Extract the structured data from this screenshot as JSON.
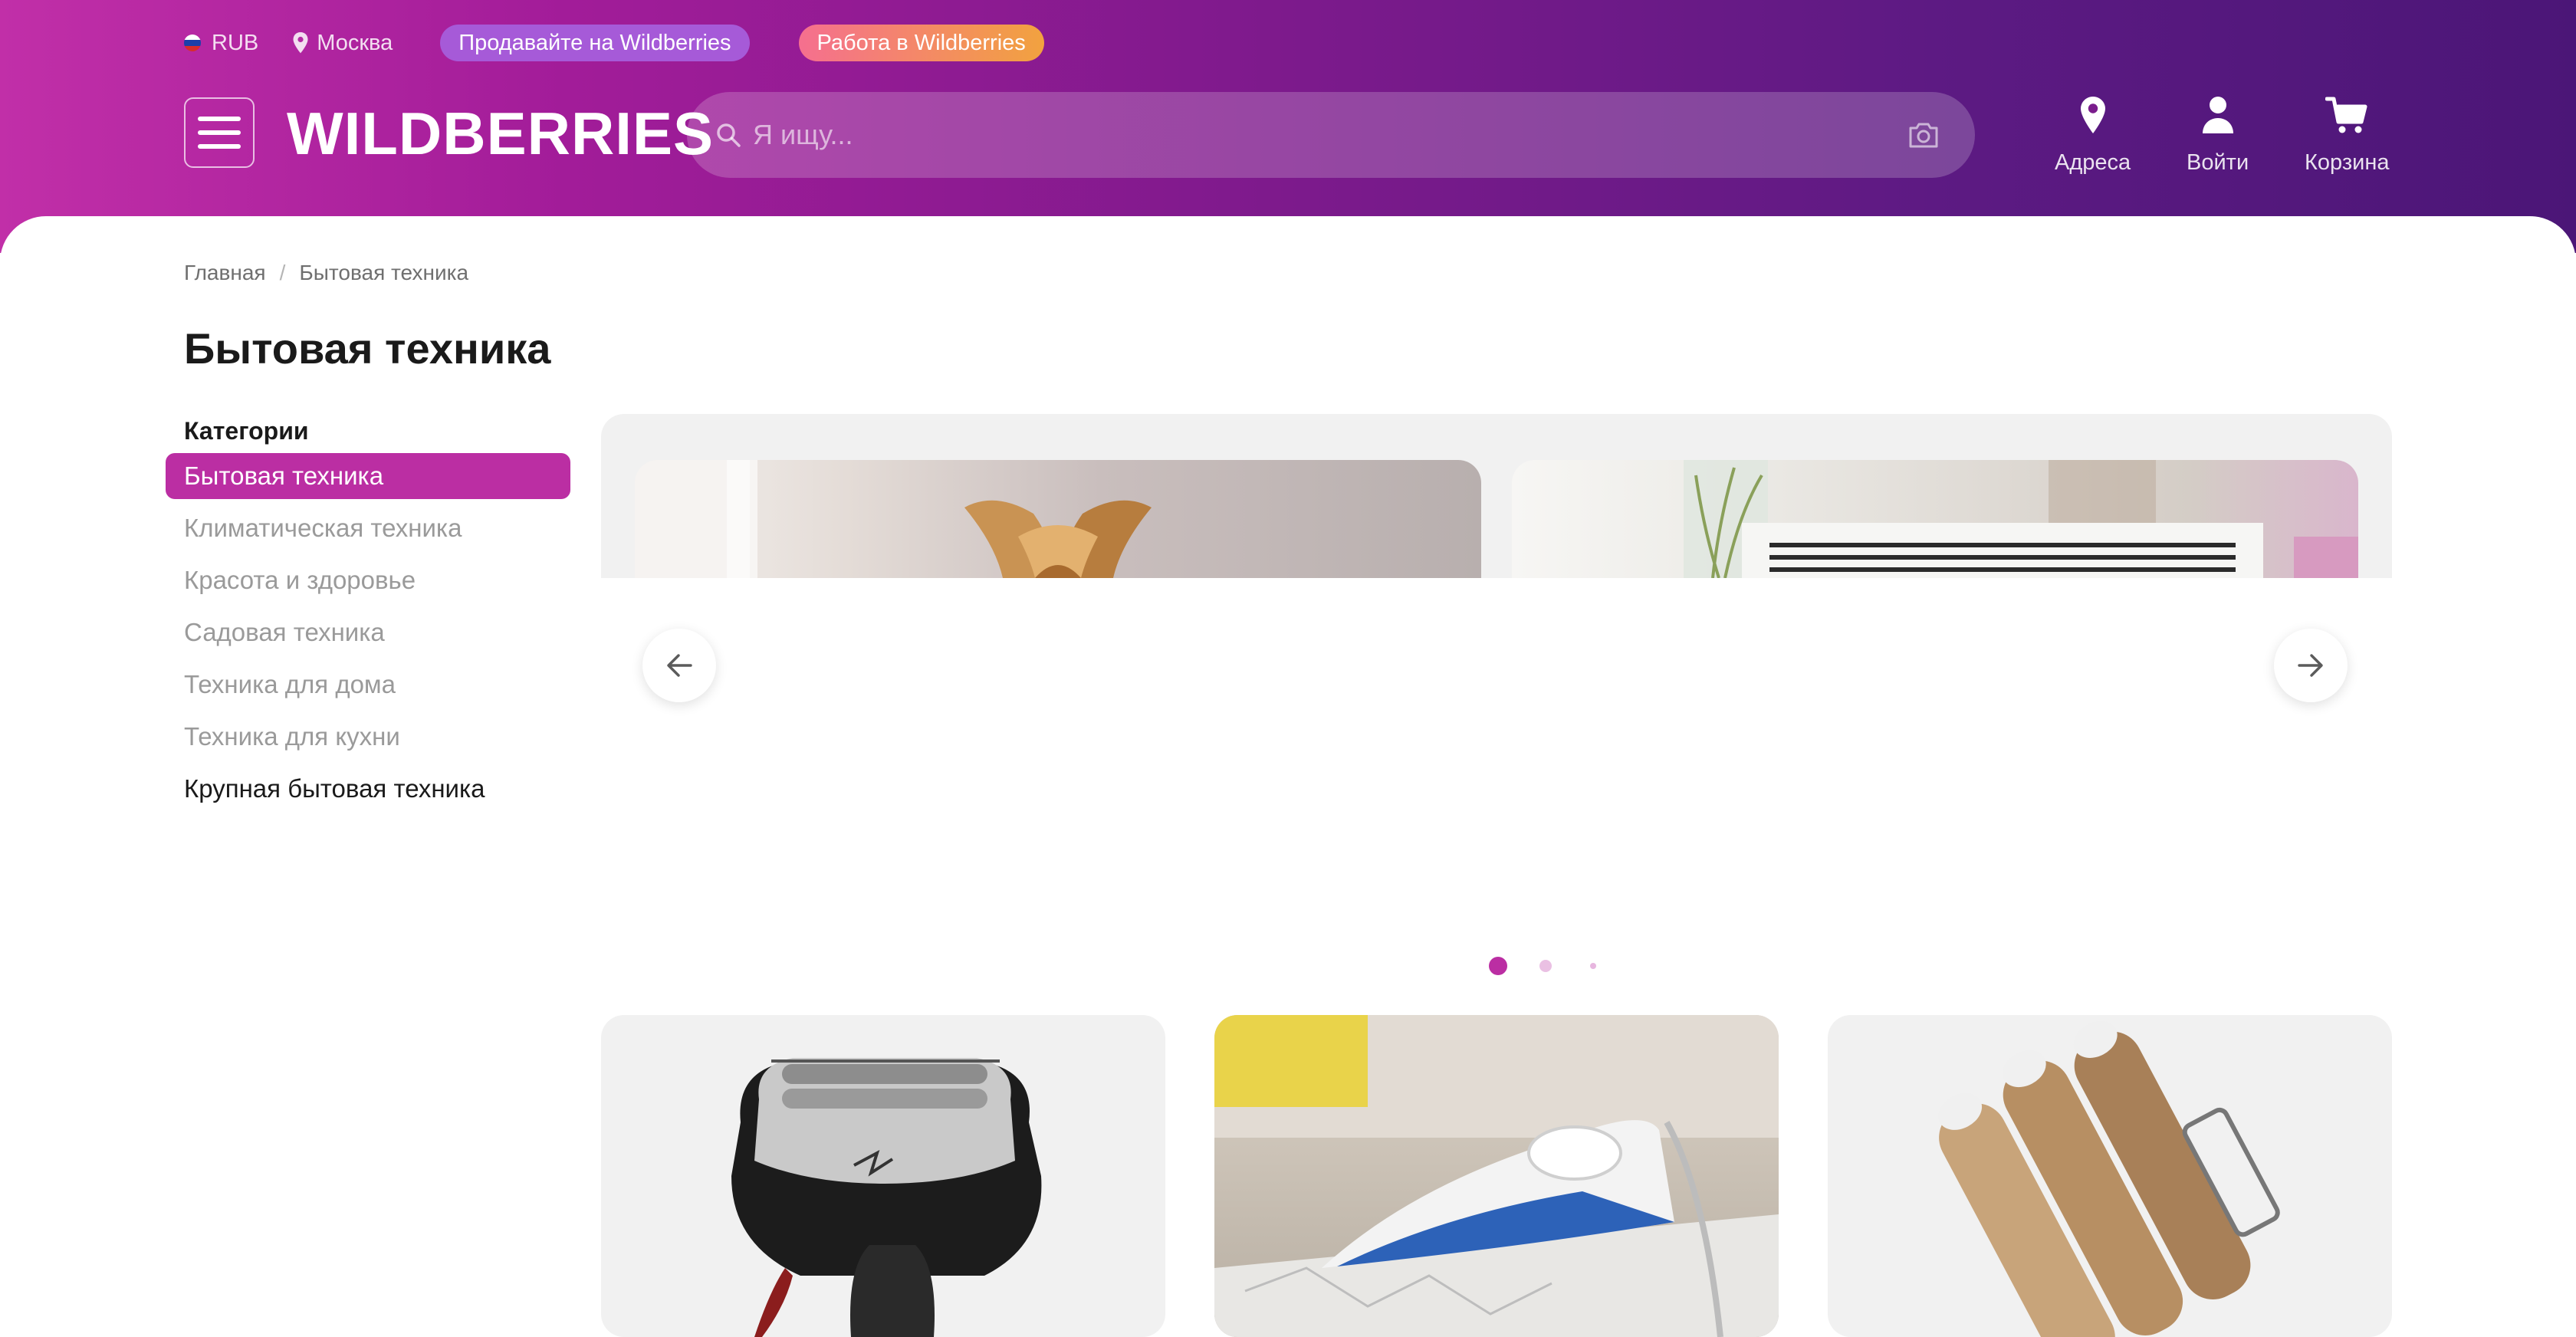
{
  "topbar": {
    "currency": "RUB",
    "city": "Москва",
    "sell_label": "Продавайте на Wildberries",
    "work_label": "Работа в Wildberries"
  },
  "header": {
    "logo": "WILDBERRIES",
    "search_placeholder": "Я ищу...",
    "nav": {
      "addresses": "Адреса",
      "login": "Войти",
      "cart": "Корзина"
    }
  },
  "breadcrumb": [
    "Главная",
    "Бытовая техника"
  ],
  "page_title": "Бытовая техника",
  "sidebar": {
    "title": "Категории",
    "items": [
      {
        "label": "Бытовая техника",
        "active": true
      },
      {
        "label": "Климатическая техника"
      },
      {
        "label": "Красота и здоровье"
      },
      {
        "label": "Садовая техника"
      },
      {
        "label": "Техника для дома"
      },
      {
        "label": "Техника для кухни"
      },
      {
        "label": "Крупная бытовая техника"
      }
    ]
  },
  "banner": {
    "slides": [
      "aroma-diffuser-photo",
      "air-conditioner-photo"
    ],
    "active_dot": 1,
    "dots": 3
  },
  "product_cards": [
    "electric-shaver-photo",
    "steam-iron-photo",
    "hair-curler-photo"
  ],
  "colors": {
    "accent": "#bb2ea3",
    "header_start": "#c12fa8",
    "header_end": "#4b1677"
  }
}
